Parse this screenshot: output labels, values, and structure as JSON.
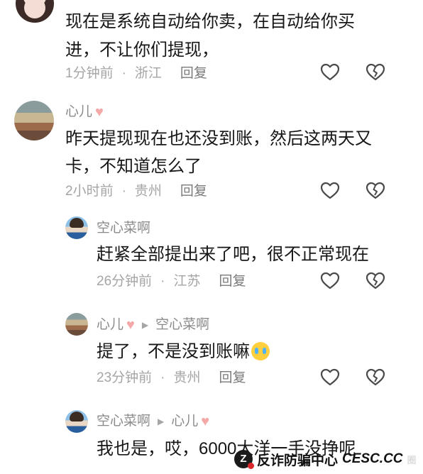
{
  "comments": [
    {
      "lines": [
        "现在是系统自动给你卖，在自动给你买",
        "进，不让你们提现，"
      ],
      "time": "1分钟前",
      "location": "浙江",
      "reply_label": "回复"
    },
    {
      "user": "心儿",
      "lines": [
        "昨天提现现在也还没到账，然后这两天又",
        "卡，不知道怎么了"
      ],
      "time": "2小时前",
      "location": "贵州",
      "reply_label": "回复"
    },
    {
      "user": "空心菜啊",
      "lines": [
        "赶紧全部提出来了吧，很不正常现在"
      ],
      "time": "26分钟前",
      "location": "江苏",
      "reply_label": "回复"
    },
    {
      "user": "心儿",
      "reply_to": "空心菜啊",
      "lines": [
        "提了，不是没到账嘛"
      ],
      "time": "23分钟前",
      "location": "贵州",
      "reply_label": "回复"
    },
    {
      "user": "空心菜啊",
      "reply_to": "心儿",
      "lines": [
        "我也是，哎，6000大洋一手没挣呢"
      ]
    }
  ],
  "watermark": {
    "logo": "Z",
    "text_cn": "反诈防骗中心",
    "text_en": "CESC.CC",
    "suffix": "圈"
  },
  "colors": {
    "name": "#8a8a8a",
    "meta": "#a5a5a5",
    "heart_badge": "#f4a8a8",
    "emoji": "#ffcf3d"
  },
  "icons": [
    "like-heart-icon",
    "dislike-broken-heart-icon",
    "heart-emoji-icon",
    "reply-arrow-icon",
    "crying-face-emoji-icon"
  ]
}
